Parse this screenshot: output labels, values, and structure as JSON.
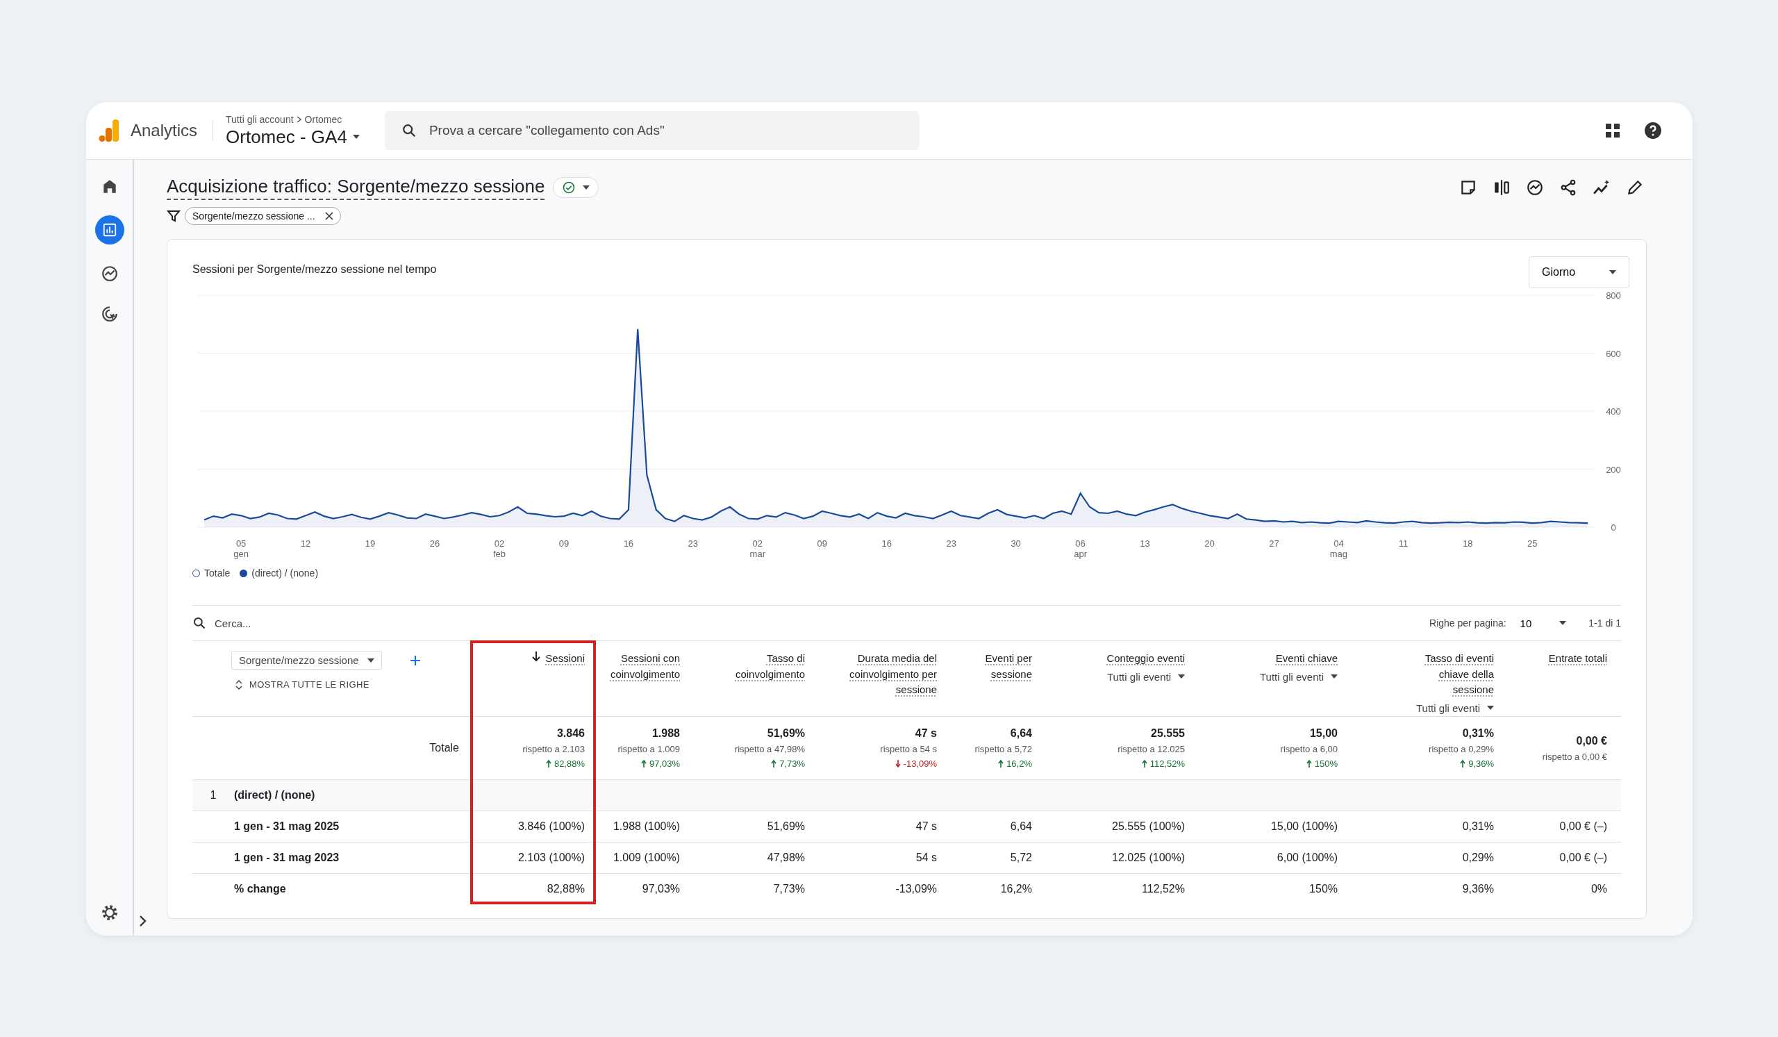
{
  "header": {
    "product": "Analytics",
    "breadcrumb": [
      "Tutti gli account",
      "Ortomec"
    ],
    "property": "Ortomec - GA4",
    "search": {
      "placeholder": "Prova a cercare \"collegamento con Ads\""
    }
  },
  "nav": [
    {
      "kind": "home",
      "selected": false
    },
    {
      "kind": "reports",
      "selected": true
    },
    {
      "kind": "explore",
      "selected": false
    },
    {
      "kind": "advertising",
      "selected": false
    }
  ],
  "report": {
    "title": "Acquisizione traffico: Sorgente/mezzo sessione",
    "verified": true,
    "filter_chip": "Sorgente/mezzo sessione ..."
  },
  "toolbar": [
    {
      "kind": "note"
    },
    {
      "kind": "compare"
    },
    {
      "kind": "insights"
    },
    {
      "kind": "share"
    },
    {
      "kind": "trend"
    },
    {
      "kind": "edit"
    }
  ],
  "chart": {
    "title": "Sessioni per Sorgente/mezzo sessione nel tempo",
    "granularity": "Giorno",
    "total_legend": "Totale",
    "chart_data": {
      "type": "area",
      "grid": true,
      "ylim": [
        0,
        800
      ],
      "yticks": [
        0,
        200,
        400,
        600,
        800
      ],
      "categories": [
        null,
        null,
        null,
        null,
        "05 gen",
        null,
        null,
        null,
        null,
        null,
        null,
        "12",
        null,
        null,
        null,
        null,
        null,
        null,
        "19",
        null,
        null,
        null,
        null,
        null,
        null,
        "26",
        null,
        null,
        null,
        null,
        null,
        null,
        "02 feb",
        null,
        null,
        null,
        null,
        null,
        null,
        "09",
        null,
        null,
        null,
        null,
        null,
        null,
        "16",
        null,
        null,
        null,
        null,
        null,
        null,
        "23",
        null,
        null,
        null,
        null,
        null,
        null,
        "02 mar",
        null,
        null,
        null,
        null,
        null,
        null,
        "09",
        null,
        null,
        null,
        null,
        null,
        null,
        "16",
        null,
        null,
        null,
        null,
        null,
        null,
        "23",
        null,
        null,
        null,
        null,
        null,
        null,
        "30",
        null,
        null,
        null,
        null,
        null,
        null,
        "06 apr",
        null,
        null,
        null,
        null,
        null,
        null,
        "13",
        null,
        null,
        null,
        null,
        null,
        null,
        "20",
        null,
        null,
        null,
        null,
        null,
        null,
        "27",
        null,
        null,
        null,
        null,
        null,
        null,
        "04 mag",
        null,
        null,
        null,
        null,
        null,
        null,
        "11",
        null,
        null,
        null,
        null,
        null,
        null,
        "18",
        null,
        null,
        null,
        null,
        null,
        null,
        "25",
        null,
        null,
        null,
        null,
        null,
        null
      ],
      "series": [
        {
          "name": "(direct) / (none)",
          "color": "#1a4a9c",
          "values": [
            25,
            38,
            32,
            45,
            40,
            30,
            35,
            48,
            42,
            30,
            28,
            40,
            52,
            38,
            30,
            36,
            44,
            34,
            28,
            38,
            50,
            42,
            32,
            30,
            45,
            38,
            30,
            35,
            42,
            50,
            44,
            36,
            40,
            52,
            70,
            48,
            45,
            40,
            36,
            38,
            48,
            40,
            55,
            38,
            30,
            28,
            60,
            683,
            180,
            60,
            30,
            20,
            40,
            30,
            25,
            35,
            55,
            70,
            45,
            30,
            28,
            40,
            35,
            50,
            42,
            30,
            38,
            55,
            48,
            40,
            35,
            45,
            30,
            50,
            38,
            32,
            48,
            40,
            36,
            30,
            42,
            55,
            40,
            35,
            30,
            48,
            60,
            44,
            38,
            32,
            40,
            30,
            48,
            55,
            45,
            117,
            70,
            50,
            48,
            55,
            45,
            40,
            52,
            60,
            70,
            78,
            65,
            55,
            48,
            40,
            35,
            30,
            45,
            28,
            25,
            20,
            22,
            18,
            20,
            16,
            18,
            15,
            14,
            20,
            18,
            16,
            22,
            18,
            15,
            14,
            18,
            20,
            16,
            14,
            15,
            17,
            16,
            18,
            15,
            14,
            16,
            15,
            18,
            17,
            14,
            16,
            20,
            18,
            16,
            15,
            14
          ]
        }
      ]
    }
  },
  "table": {
    "search": {
      "placeholder": "Cerca..."
    },
    "rows_per_page_label": "Righe per pagina:",
    "rows_per_page": "10",
    "pagination": "1-1 di 1",
    "dimension": "Sorgente/mezzo sessione",
    "show_all": "MOSTRA TUTTE LE RIGHE",
    "columns": [
      {
        "title": "Sessioni",
        "sorted": true,
        "highlighted": true
      },
      {
        "title": "Sessioni con coinvolgimento",
        "sorted": false,
        "highlighted": false
      },
      {
        "title": "Tasso di coinvolgimento",
        "sorted": false,
        "highlighted": false
      },
      {
        "title": "Durata media del coinvolgimento per sessione",
        "sorted": false,
        "highlighted": false
      },
      {
        "title": "Eventi per sessione",
        "sorted": false,
        "highlighted": false
      },
      {
        "title": "Conteggio eventi",
        "subtitle": "Tutti gli eventi",
        "sorted": false,
        "highlighted": false
      },
      {
        "title": "Eventi chiave",
        "subtitle": "Tutti gli eventi",
        "sorted": false,
        "highlighted": false
      },
      {
        "title": "Tasso di eventi chiave della sessione",
        "subtitle": "Tutti gli eventi",
        "sorted": false,
        "highlighted": false
      },
      {
        "title": "Entrate totali",
        "sorted": false,
        "highlighted": false
      }
    ],
    "totals": {
      "label": "Totale",
      "cells": [
        {
          "value": "3.846",
          "compare": "rispetto a 2.103",
          "change": "82,88%",
          "increase": true
        },
        {
          "value": "1.988",
          "compare": "rispetto a 1.009",
          "change": "97,03%",
          "increase": true
        },
        {
          "value": "51,69%",
          "compare": "rispetto a 47,98%",
          "change": "7,73%",
          "increase": true
        },
        {
          "value": "47 s",
          "compare": "rispetto a 54 s",
          "change": "-13,09%",
          "increase": false
        },
        {
          "value": "6,64",
          "compare": "rispetto a 5,72",
          "change": "16,2%",
          "increase": true
        },
        {
          "value": "25.555",
          "compare": "rispetto a 12.025",
          "change": "112,52%",
          "increase": true
        },
        {
          "value": "15,00",
          "compare": "rispetto a 6,00",
          "change": "150%",
          "increase": true
        },
        {
          "value": "0,31%",
          "compare": "rispetto a 0,29%",
          "change": "9,36%",
          "increase": true
        },
        {
          "value": "0,00 €",
          "compare": "rispetto a 0,00 €"
        }
      ]
    },
    "rows": [
      {
        "kind": "group",
        "index": "1",
        "label": "(direct) / (none)"
      },
      {
        "kind": "data",
        "label": "1 gen - 31 mag 2025",
        "cells": [
          "3.846 (100%)",
          "1.988 (100%)",
          "51,69%",
          "47 s",
          "6,64",
          "25.555 (100%)",
          "15,00 (100%)",
          "0,31%",
          "0,00 € (–)"
        ]
      },
      {
        "kind": "data",
        "label": "1 gen - 31 mag 2023",
        "cells": [
          "2.103 (100%)",
          "1.009 (100%)",
          "47,98%",
          "54 s",
          "5,72",
          "12.025 (100%)",
          "6,00 (100%)",
          "0,29%",
          "0,00 € (–)"
        ]
      },
      {
        "kind": "data",
        "label": "% change",
        "cells": [
          "82,88%",
          "97,03%",
          "7,73%",
          "-13,09%",
          "16,2%",
          "112,52%",
          "150%",
          "9,36%",
          "0%"
        ]
      }
    ]
  }
}
